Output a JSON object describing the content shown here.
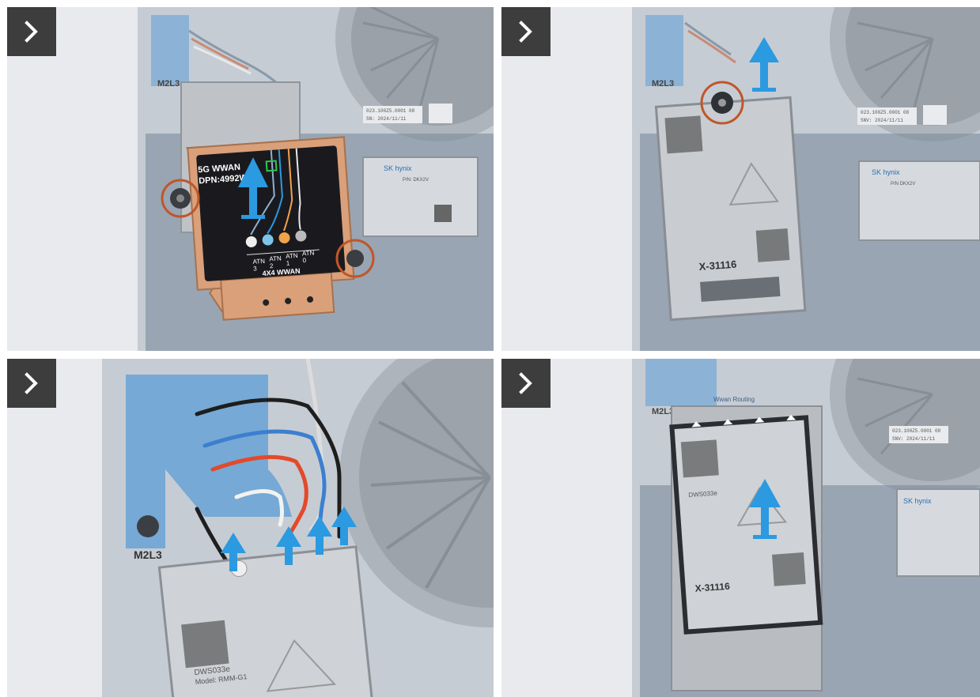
{
  "nav_icon": "chevron-right-icon",
  "colors": {
    "arrow_blue": "#2b9ae0",
    "highlight_circle": "#c0562a",
    "copper": "#d9a07a",
    "nav_bg": "#3d3d3d"
  },
  "panels": {
    "p1": {
      "shield_line1": "5G WWAN",
      "shield_line2": "DPN:4992W",
      "shield_bottom": "4X4 WWAN",
      "atn_3": "ATN\n3",
      "atn_2": "ATN\n2",
      "atn_1": "ATN\n1",
      "atn_0": "ATN\n0",
      "screw_label": "M2L3",
      "fan_label_1": "023.100Z5.0001 08",
      "fan_label_2": "SN: 2024/11/11",
      "ssd_brand": "SK hynix",
      "ssd_pn": "P/N: DKX2V"
    },
    "p2": {
      "screw_label": "M2L3",
      "fan_label_1": "023.100Z5.0001 08",
      "fan_label_2": "SNV: 2024/11/11",
      "ssd_brand": "SK hynix",
      "ssd_pn": "P/N DKX2V",
      "card_code": "X-31116"
    },
    "p3": {
      "screw_label": "M2L3",
      "card_model": "DWS033e",
      "card_sub": "Model: RMM-G1"
    },
    "p4": {
      "screw_label": "M2L3",
      "routing_label": "Wwan Routing",
      "card_code": "X-31116",
      "card_model": "DWS033e",
      "ssd_brand": "SK hynix",
      "fan_label_1": "023.100Z5.0001 08",
      "fan_label_2": "SNV: 2024/11/11"
    }
  }
}
